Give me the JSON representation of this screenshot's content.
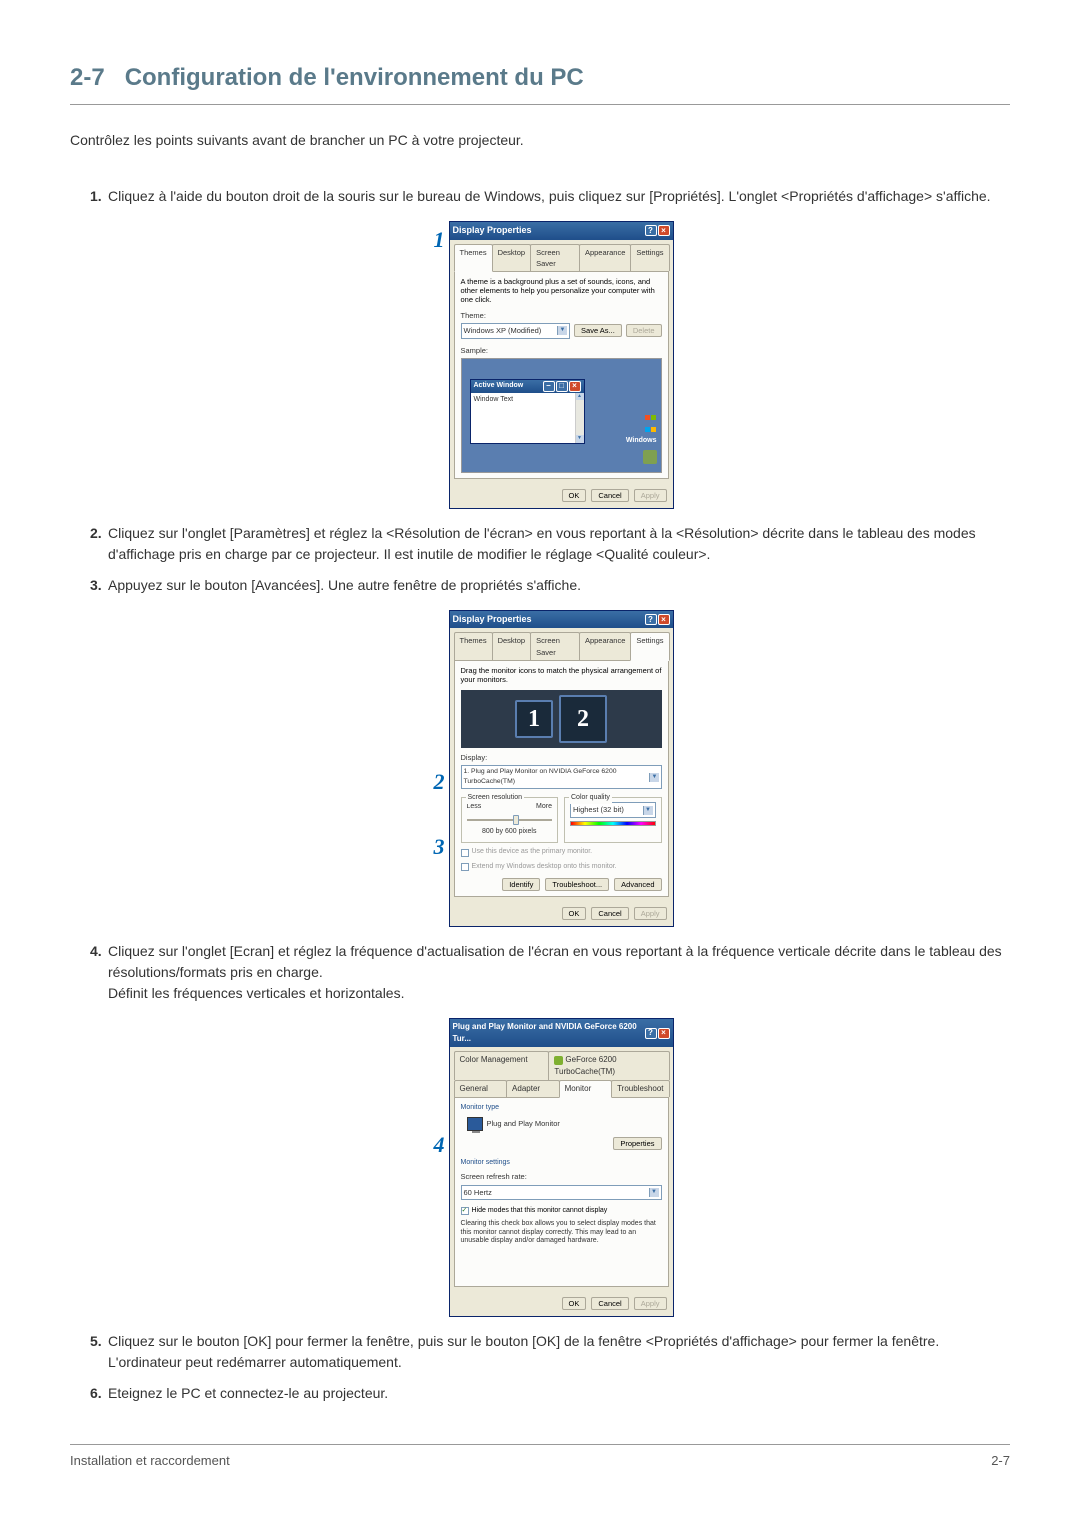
{
  "section": {
    "number": "2-7",
    "title": "Configuration de l'environnement du PC"
  },
  "intro": "Contrôlez les points suivants avant de brancher un PC à votre projecteur.",
  "steps": {
    "s1": "Cliquez à l'aide du bouton droit de la souris sur le bureau de Windows, puis cliquez sur [Propriétés]. L'onglet <Propriétés d'affichage> s'affiche.",
    "s2": "Cliquez sur l'onglet [Paramètres] et réglez la <Résolution de l'écran> en vous reportant à la <Résolution> décrite dans le tableau des modes d'affichage pris en charge par ce projecteur. Il est inutile de modifier le réglage <Qualité couleur>.",
    "s3": "Appuyez sur le bouton [Avancées]. Une autre fenêtre de propriétés s'affiche.",
    "s4a": "Cliquez sur l'onglet [Ecran] et réglez la fréquence d'actualisation de l'écran en vous reportant à la fréquence verticale décrite dans le tableau des résolutions/formats pris en charge.",
    "s4b": "Définit les fréquences verticales et horizontales.",
    "s5": "Cliquez sur le bouton [OK] pour fermer la fenêtre, puis sur le bouton [OK] de la fenêtre <Propriétés d'affichage> pour fermer la fenêtre. L'ordinateur peut redémarrer automatiquement.",
    "s6": "Eteignez le PC et connectez-le au projecteur."
  },
  "callouts": {
    "c1": "1",
    "c2": "2",
    "c3": "3",
    "c4": "4"
  },
  "dlg1": {
    "title": "Display Properties",
    "tabs": {
      "themes": "Themes",
      "desktop": "Desktop",
      "saver": "Screen Saver",
      "appearance": "Appearance",
      "settings": "Settings"
    },
    "desc": "A theme is a background plus a set of sounds, icons, and other elements to help you personalize your computer with one click.",
    "theme_label": "Theme:",
    "theme_value": "Windows XP (Modified)",
    "save_as": "Save As...",
    "delete": "Delete",
    "sample_label": "Sample:",
    "active_window": "Active Window",
    "window_text": "Window Text",
    "win_brand": "Windows",
    "ok": "OK",
    "cancel": "Cancel",
    "apply": "Apply"
  },
  "dlg2": {
    "title": "Display Properties",
    "desc": "Drag the monitor icons to match the physical arrangement of your monitors.",
    "mon1": "1",
    "mon2": "2",
    "display_label": "Display:",
    "display_value": "1. Plug and Play Monitor on NVIDIA GeForce 6200 TurboCache(TM)",
    "res_label": "Screen resolution",
    "less": "Less",
    "more": "More",
    "res_value": "800 by 600 pixels",
    "cq_label": "Color quality",
    "cq_value": "Highest (32 bit)",
    "use_primary": "Use this device as the primary monitor.",
    "extend": "Extend my Windows desktop onto this monitor.",
    "identify": "Identify",
    "troubleshoot": "Troubleshoot...",
    "advanced": "Advanced",
    "ok": "OK",
    "cancel": "Cancel",
    "apply": "Apply"
  },
  "dlg3": {
    "title": "Plug and Play Monitor and NVIDIA GeForce 6200 Tur...",
    "tab_cm": "Color Management",
    "tab_gf": "GeForce 6200 TurboCache(TM)",
    "tab_general": "General",
    "tab_adapter": "Adapter",
    "tab_monitor": "Monitor",
    "tab_ts": "Troubleshoot",
    "mtype_label": "Monitor type",
    "mtype_value": "Plug and Play Monitor",
    "properties": "Properties",
    "msettings_label": "Monitor settings",
    "refresh_label": "Screen refresh rate:",
    "refresh_value": "60 Hertz",
    "hide_modes": "Hide modes that this monitor cannot display",
    "hide_desc": "Clearing this check box allows you to select display modes that this monitor cannot display correctly. This may lead to an unusable display and/or damaged hardware.",
    "ok": "OK",
    "cancel": "Cancel",
    "apply": "Apply"
  },
  "footer": {
    "left": "Installation et raccordement",
    "right": "2-7"
  }
}
